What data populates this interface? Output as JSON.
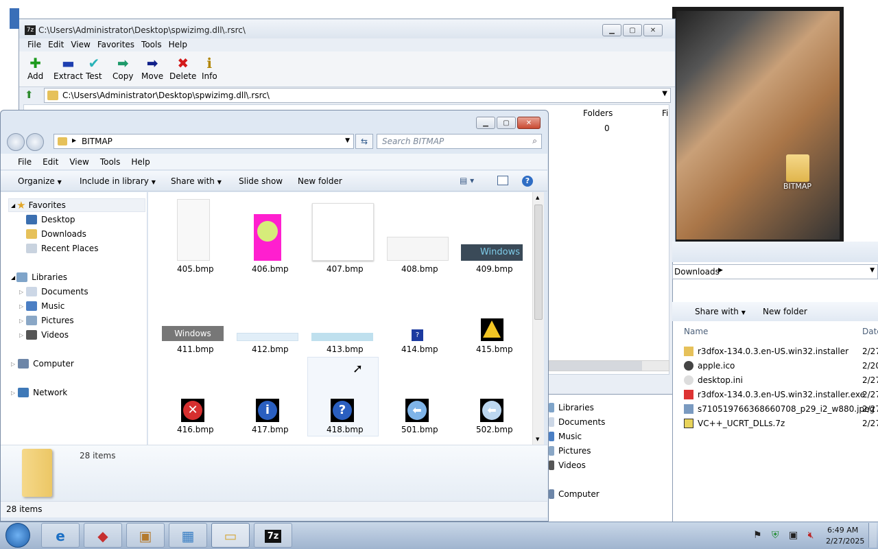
{
  "sevenzip": {
    "title": "C:\\Users\\Administrator\\Desktop\\spwizimg.dll\\.rsrc\\",
    "menu": [
      "File",
      "Edit",
      "View",
      "Favorites",
      "Tools",
      "Help"
    ],
    "toolbar": [
      "Add",
      "Extract",
      "Test",
      "Copy",
      "Move",
      "Delete",
      "Info"
    ],
    "path": "C:\\Users\\Administrator\\Desktop\\spwizimg.dll\\.rsrc\\",
    "col_folders": "Folders",
    "col_f": "Fi",
    "folders_value": "0"
  },
  "explorer": {
    "address": "BITMAP",
    "search_placeholder": "Search BITMAP",
    "menu": [
      "File",
      "Edit",
      "View",
      "Tools",
      "Help"
    ],
    "commands": {
      "organize": "Organize",
      "include": "Include in library",
      "share": "Share with",
      "slideshow": "Slide show",
      "newfolder": "New folder"
    },
    "nav": {
      "favorites": "Favorites",
      "desktop": "Desktop",
      "downloads": "Downloads",
      "recent": "Recent Places",
      "libraries": "Libraries",
      "documents": "Documents",
      "music": "Music",
      "pictures": "Pictures",
      "videos": "Videos",
      "computer": "Computer",
      "network": "Network"
    },
    "files": [
      "405.bmp",
      "406.bmp",
      "407.bmp",
      "408.bmp",
      "409.bmp",
      "411.bmp",
      "412.bmp",
      "413.bmp",
      "414.bmp",
      "415.bmp",
      "416.bmp",
      "417.bmp",
      "418.bmp",
      "501.bmp",
      "502.bmp"
    ],
    "details_count": "28 items",
    "status": "28 items",
    "windows_text": "Windows"
  },
  "downloads": {
    "address": "Downloads",
    "commands": {
      "share": "Share with",
      "newfolder": "New folder"
    },
    "col_name": "Name",
    "col_date": "Date",
    "items": [
      {
        "name": "r3dfox-134.0.3.en-US.win32.installer",
        "date": "2/27"
      },
      {
        "name": "apple.ico",
        "date": "2/20"
      },
      {
        "name": "desktop.ini",
        "date": "2/27"
      },
      {
        "name": "r3dfox-134.0.3.en-US.win32.installer.exe",
        "date": "2/27"
      },
      {
        "name": "s7105197663686607​08_p29_i2_w880.jpeg",
        "date": "2/27"
      },
      {
        "name": "VC++_UCRT_DLLs.7z",
        "date": "2/27"
      }
    ]
  },
  "left_nav2": {
    "libraries": "Libraries",
    "documents": "Documents",
    "music": "Music",
    "pictures": "Pictures",
    "videos": "Videos",
    "computer": "Computer"
  },
  "desktop_icon_label": "BITMAP",
  "clock": {
    "time": "6:49 AM",
    "date": "2/27/2025"
  }
}
